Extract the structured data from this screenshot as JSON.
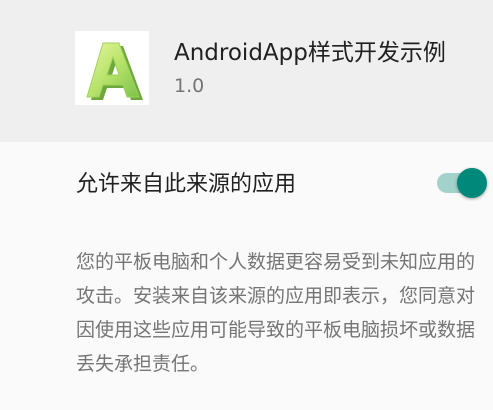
{
  "app": {
    "name": "AndroidApp样式开发示例",
    "version": "1.0",
    "icon": "android-app-letter-a-icon",
    "icon_letter": "A"
  },
  "setting": {
    "label": "允许来自此来源的应用",
    "enabled": true,
    "accent_color": "#00897b"
  },
  "description": "您的平板电脑和个人数据更容易受到未知应用的攻击。安装来自该来源的应用即表示，您同意对因使用这些应用可能导致的平板电脑损坏或数据丢失承担责任。"
}
